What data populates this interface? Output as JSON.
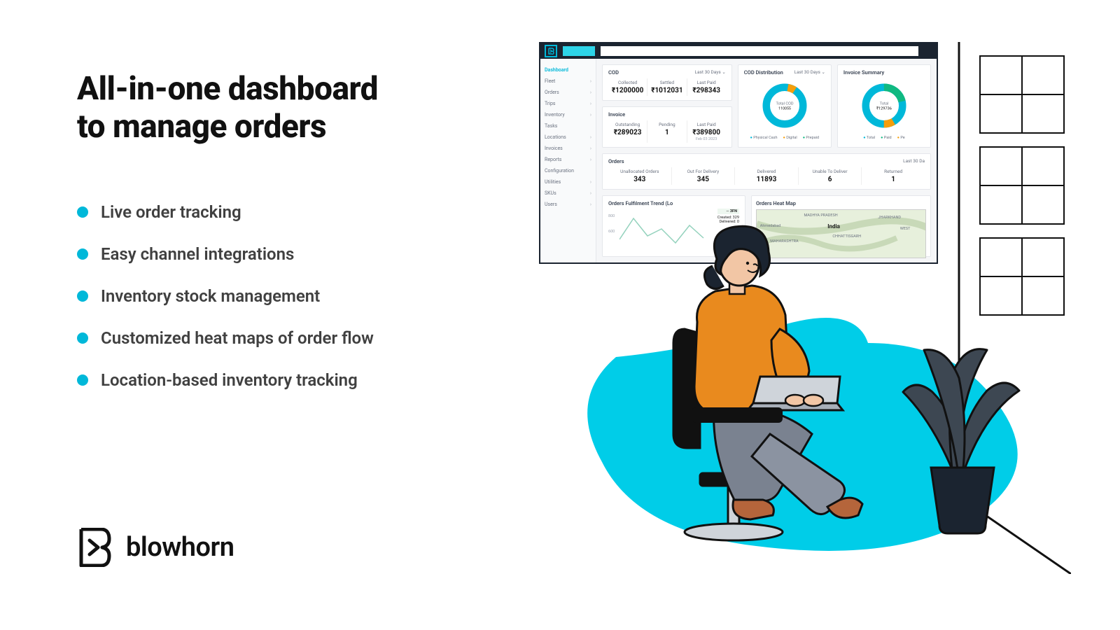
{
  "headline_l1": "All-in-one dashboard",
  "headline_l2": "to manage orders",
  "features": [
    "Live order tracking",
    "Easy channel integrations",
    "Inventory stock management",
    "Customized heat maps of order flow",
    "Location-based inventory tracking"
  ],
  "brand_name": "blowhorn",
  "dash": {
    "sidebar": [
      "Dashboard",
      "Fleet",
      "Orders",
      "Trips",
      "Inventory",
      "Tasks",
      "Locations",
      "Invoices",
      "Reports",
      "Configuration",
      "Utilities",
      "SKUs",
      "Users"
    ],
    "filter": "Last 30 Days",
    "cod": {
      "title": "COD",
      "stats": [
        {
          "label": "Collected",
          "value": "₹1200000"
        },
        {
          "label": "Settled",
          "value": "₹1012031"
        },
        {
          "label": "Last Paid",
          "value": "₹298343"
        }
      ]
    },
    "invoice": {
      "title": "Invoice",
      "stats": [
        {
          "label": "Outstanding",
          "value": "₹289023"
        },
        {
          "label": "Pending",
          "value": "1"
        },
        {
          "label": "Last Paid",
          "value": "₹389800",
          "sub": "Feb 03 2023"
        }
      ]
    },
    "cod_dist": {
      "title": "COD Distribution",
      "center_label": "Total COD",
      "center_value": "110055",
      "legend": [
        "Physical Cash",
        "Digital",
        "Prepaid"
      ]
    },
    "inv_sum": {
      "title": "Invoice Summary",
      "center_label": "Total",
      "center_value": "₹129736",
      "legend": [
        "Total",
        "Paid",
        "Pe"
      ]
    },
    "orders": {
      "title": "Orders",
      "filter": "Last 30 Da",
      "stats": [
        {
          "label": "Unallocated Orders",
          "value": "343"
        },
        {
          "label": "Out For Delivery",
          "value": "345"
        },
        {
          "label": "Delivered",
          "value": "11893"
        },
        {
          "label": "Unable To Deliver",
          "value": "6"
        },
        {
          "label": "Returned",
          "value": "1"
        }
      ]
    },
    "trend": {
      "title": "Orders Fulfilment Trend (Lo",
      "badge1": "Created: 329",
      "badge2": "Delivered: 0",
      "y0": "800",
      "y1": "600"
    },
    "heatmap": {
      "title": "Orders Heat Map",
      "country": "India",
      "l1": "MADHYA PRADESH",
      "l2": "Ahmedabad",
      "l3": "MAHARASHTRA",
      "l4": "CHHATTISGARH",
      "l5": "JHARKHAND",
      "l6": "WEST"
    }
  }
}
